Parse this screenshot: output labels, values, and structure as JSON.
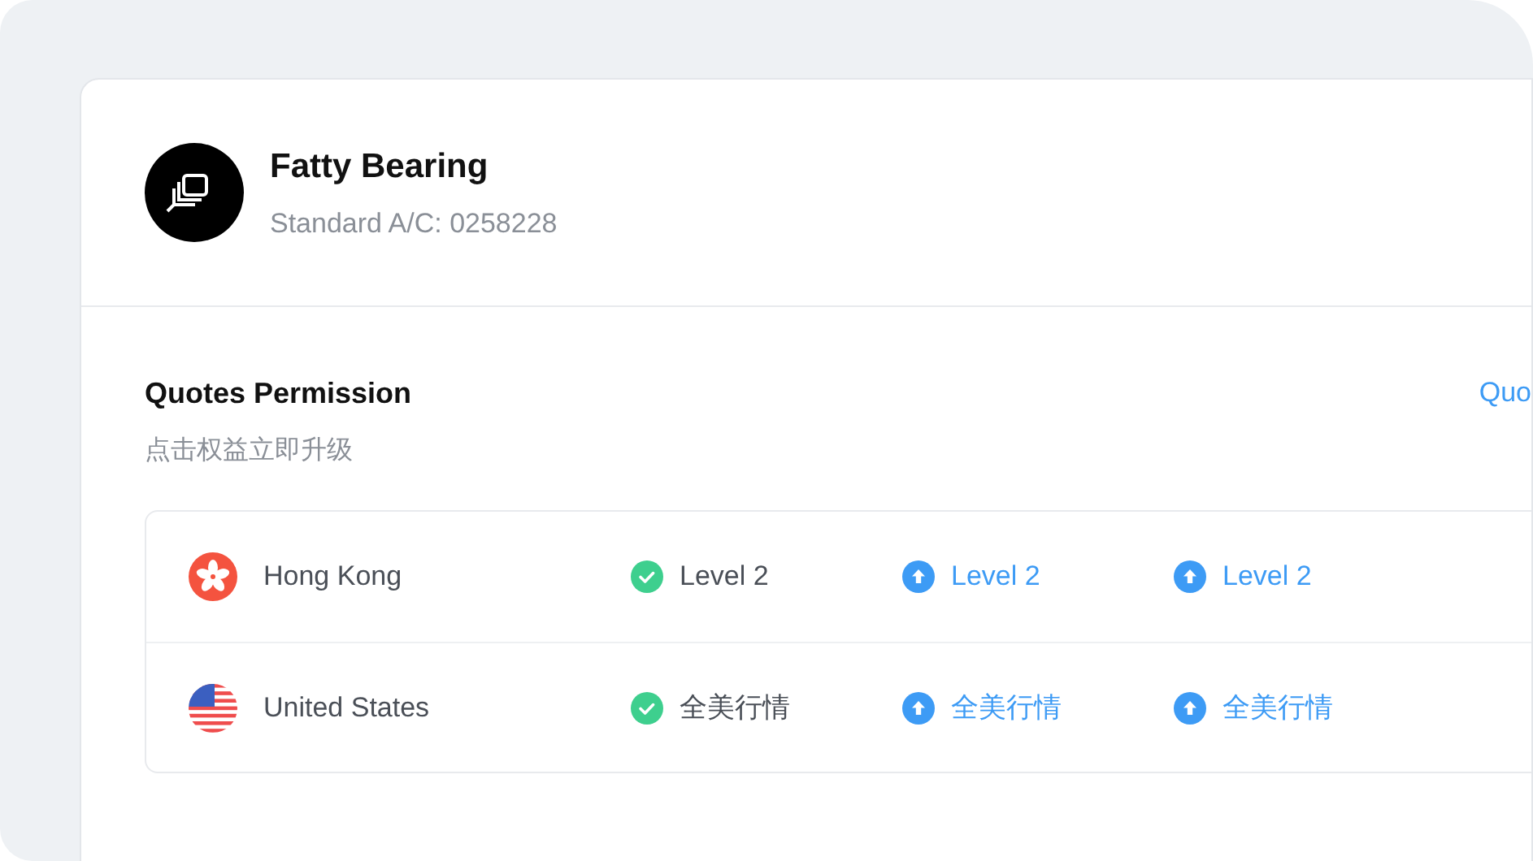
{
  "account": {
    "name": "Fatty Bearing",
    "subtitle": "Standard A/C: 0258228"
  },
  "section": {
    "title": "Quotes Permission",
    "subtitle": "点击权益立即升级",
    "link": "Quo"
  },
  "markets": [
    {
      "kind": "hk",
      "name": "Hong Kong",
      "levels": [
        {
          "kind": "owned",
          "label": "Level 2"
        },
        {
          "kind": "upgrade",
          "label": "Level 2"
        },
        {
          "kind": "upgrade",
          "label": "Level 2"
        }
      ]
    },
    {
      "kind": "us",
      "name": "United States",
      "levels": [
        {
          "kind": "owned",
          "label": "全美行情"
        },
        {
          "kind": "upgrade",
          "label": "全美行情"
        },
        {
          "kind": "upgrade",
          "label": "全美行情"
        }
      ]
    }
  ]
}
